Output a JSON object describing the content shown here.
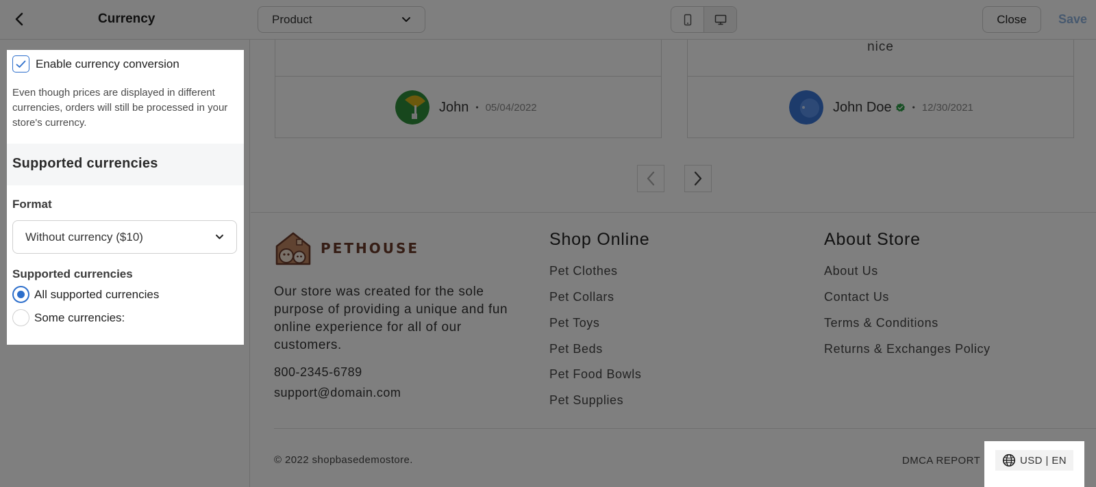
{
  "header": {
    "title": "Currency",
    "page_select_value": "Product",
    "close_label": "Close",
    "save_label": "Save",
    "icons": [
      "chevron-left-icon",
      "chevron-down-icon",
      "mobile-icon",
      "desktop-icon"
    ]
  },
  "settings": {
    "enable_label": "Enable currency conversion",
    "enable_checked": true,
    "help_text": "Even though prices are displayed in different currencies, orders will still be processed in your store's currency.",
    "section_title": "Supported currencies",
    "format_label": "Format",
    "format_value": "Without currency ($10)",
    "supported_label": "Supported currencies",
    "options": [
      {
        "label": "All supported currencies",
        "checked": true
      },
      {
        "label": "Some currencies:",
        "checked": false
      }
    ]
  },
  "reviews": [
    {
      "text": "",
      "name": "John",
      "date": "05/04/2022",
      "verified": false
    },
    {
      "text": "nice",
      "name": "John Doe",
      "date": "12/30/2021",
      "verified": true
    }
  ],
  "footer": {
    "brand_name": "PETHOUSE",
    "description": "Our store was created for the sole purpose of providing a unique and fun online experience for all of our customers.",
    "phone": "800-2345-6789",
    "email": "support@domain.com",
    "shop_title": "Shop Online",
    "shop_links": [
      "Pet Clothes",
      "Pet Collars",
      "Pet Toys",
      "Pet Beds",
      "Pet Food Bowls",
      "Pet Supplies"
    ],
    "about_title": "About Store",
    "about_links": [
      "About Us",
      "Contact Us",
      "Terms & Conditions",
      "Returns & Exchanges Policy"
    ],
    "copyright": "© 2022 shopbasedemostore.",
    "dmca": "DMCA REPORT",
    "locale": "USD | EN"
  },
  "colors": {
    "accent": "#2c6ecb",
    "save_disabled": "#8fb3de",
    "brand": "#6b3b2a",
    "verified": "#2e9e48",
    "overlay": "rgba(0,0,0,0.5)"
  }
}
